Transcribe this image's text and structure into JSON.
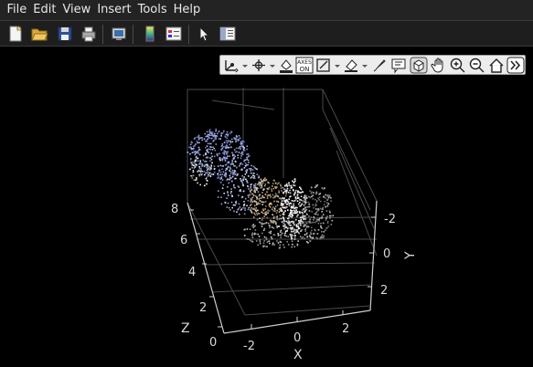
{
  "menu": [
    "File",
    "Edit",
    "View",
    "Insert",
    "Tools",
    "Help"
  ],
  "toolbar": {
    "buttons": [
      "new-figure",
      "open-file",
      "save-figure",
      "print-figure",
      "link-plot",
      "insert-colorbar",
      "insert-legend",
      "edit-plot",
      "property-inspector"
    ]
  },
  "axes_toolbar": {
    "buttons": [
      "data-tips",
      "rotate-3d",
      "brush-data",
      "axes-on",
      "restore-view",
      "fill-color",
      "edit-brush",
      "insert-text",
      "rotate-view",
      "pan",
      "zoom-in",
      "zoom-out",
      "home",
      "more"
    ],
    "axes_on_label": "AXES ON"
  },
  "axes": {
    "z_label": "Z",
    "x_label": "X",
    "y_label": "Y",
    "z_ticks": [
      "8",
      "6",
      "4",
      "2",
      "0"
    ],
    "x_ticks": [
      "-2",
      "0",
      "2"
    ],
    "y_ticks": [
      "-2",
      "0",
      "2"
    ]
  },
  "colors": {
    "background": "#000000",
    "menubar": "#232323",
    "toolbar": "#1e1e1e",
    "axis_lines": "#cfcfcf",
    "grid_lines": "#4a4a4a",
    "points_blue": "#8f9dd8",
    "points_white": "#f2f2f2",
    "points_gray": "#8a8a8a",
    "points_warm": "#c9a06a"
  }
}
